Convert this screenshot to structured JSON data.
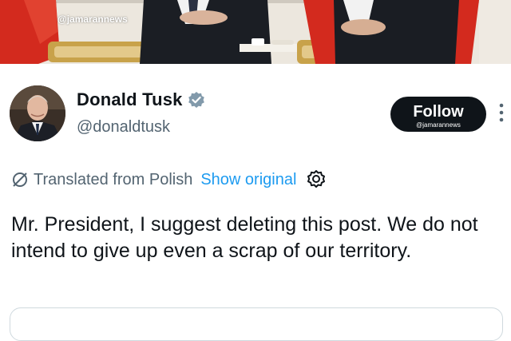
{
  "photo": {
    "watermark": "@jamarannews"
  },
  "profile": {
    "display_name": "Donald Tusk",
    "handle": "@donaldtusk",
    "verified": true,
    "verified_icon": "verified-badge-icon"
  },
  "follow_button": {
    "label": "Follow",
    "watermark": "@jamarannews"
  },
  "translation": {
    "label": "Translated from Polish",
    "show_original": "Show original",
    "icon": "translate-icon",
    "settings_icon": "gear-icon"
  },
  "tweet": {
    "text": "Mr. President, I suggest deleting this post. We do not intend to give up even a scrap of our territory."
  },
  "colors": {
    "text": "#0f1419",
    "secondary": "#536471",
    "link": "#1d9bf0",
    "follow_bg": "#0f1419"
  }
}
